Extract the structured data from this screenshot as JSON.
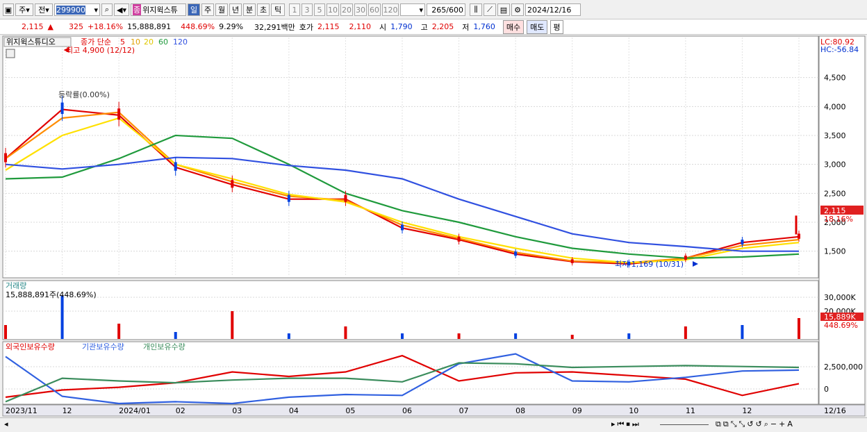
{
  "toolbar": {
    "period_type": "주",
    "prev_label": "전",
    "code": "299900",
    "name_badge": "종",
    "name": "위지윅스튜",
    "period_buttons": [
      "일",
      "주",
      "월",
      "년",
      "분",
      "초",
      "틱"
    ],
    "active_period": "일",
    "interval_buttons": [
      "1",
      "3",
      "5",
      "10",
      "20",
      "30",
      "60",
      "120"
    ],
    "count": "265",
    "count_max": "/600",
    "date": "2024/12/16"
  },
  "quote": {
    "price": "2,115",
    "change_arrow": "▲",
    "change": "325",
    "change_pct": "+18.16%",
    "volume": "15,888,891",
    "volume_pct": "448.69%",
    "rate": "9.29%",
    "amount": "32,291백만",
    "hoga_label": "호가",
    "hoga_ask": "2,115",
    "hoga_bid": "2,110",
    "open_label": "시",
    "open": "1,790",
    "high_label": "고",
    "high": "2,205",
    "low_label": "저",
    "low": "1,760",
    "buy_label": "매수",
    "sell_label": "매도",
    "eval_label": "평"
  },
  "price_panel": {
    "name_label": "위지윅스튜디오",
    "ma_title": "종가 단순",
    "ma_periods": [
      "5",
      "10",
      "20",
      "60",
      "120"
    ],
    "max_annotation": "최고 4,900 (12/12)",
    "min_annotation": "최저 1,169 (10/31)",
    "ratio_annotation": "등락률(0.00%)",
    "lc_label": "LC:80.92",
    "hc_label": "HC:-56.84",
    "last_price_badge": "2,115",
    "last_change_badge": "18.16%",
    "y_ticks": [
      "4,500",
      "4,000",
      "3,500",
      "3,000",
      "2,500",
      "2,000",
      "1,500"
    ]
  },
  "volume_panel": {
    "title": "거래량",
    "value_label": "15,888,891주(448.69%)",
    "y_ticks": [
      "30,000K",
      "20,000K"
    ],
    "last_badge": "15,889K",
    "last_pct": "448.69%"
  },
  "holding_panel": {
    "foreign_label": "외국인보유수량",
    "inst_label": "기관보유수량",
    "retail_label": "개인보유수량",
    "y_ticks": [
      "2,500,000",
      "0"
    ]
  },
  "x_axis": {
    "labels": [
      "2023/11",
      "12",
      "2024/01",
      "02",
      "03",
      "04",
      "05",
      "06",
      "07",
      "08",
      "09",
      "10",
      "11",
      "12",
      "12/16"
    ]
  },
  "colors": {
    "ma5": "#e00000",
    "ma10": "#ff8c00",
    "ma20": "#ffe000",
    "ma60": "#1f9a3c",
    "ma120": "#3050e0",
    "up": "#e00000",
    "down": "#0040e0",
    "foreign": "#e00000",
    "inst": "#3060e0",
    "retail": "#3a8c5c"
  },
  "chart_data": {
    "type": "line",
    "x_range": [
      "2023/11",
      "2024/12/16"
    ],
    "ylim": [
      1100,
      5000
    ],
    "x": [
      "2023/11",
      "2023/12",
      "2024/01",
      "2024/02",
      "2024/03",
      "2024/04",
      "2024/05",
      "2024/06",
      "2024/07",
      "2024/08",
      "2024/09",
      "2024/10",
      "2024/11",
      "2024/12",
      "2024/12/16"
    ],
    "series": [
      {
        "name": "5",
        "values": [
          3100,
          3950,
          3850,
          2950,
          2650,
          2400,
          2400,
          1900,
          1700,
          1450,
          1320,
          1280,
          1380,
          1650,
          1750
        ]
      },
      {
        "name": "10",
        "values": [
          3100,
          3800,
          3900,
          3000,
          2700,
          2450,
          2380,
          1950,
          1720,
          1480,
          1330,
          1300,
          1380,
          1600,
          1700
        ]
      },
      {
        "name": "20",
        "values": [
          2900,
          3500,
          3800,
          3000,
          2750,
          2480,
          2350,
          2000,
          1750,
          1550,
          1380,
          1300,
          1350,
          1550,
          1650
        ]
      },
      {
        "name": "60",
        "values": [
          2750,
          2780,
          3100,
          3500,
          3450,
          3000,
          2500,
          2200,
          2000,
          1750,
          1550,
          1450,
          1380,
          1400,
          1450
        ]
      },
      {
        "name": "120",
        "values": [
          3000,
          2920,
          3000,
          3120,
          3100,
          2980,
          2900,
          2750,
          2400,
          2100,
          1800,
          1650,
          1580,
          1500,
          1500
        ]
      }
    ],
    "last_close": 2115,
    "max_point": {
      "date": "2023/12/12",
      "value": 4900
    },
    "min_point": {
      "date": "2024/10/31",
      "value": 1169
    },
    "volume_last": "15,889K",
    "holdings": [
      {
        "name": "외국인보유수량",
        "values": [
          -0.3,
          0.5,
          0.8,
          1.3,
          2.5,
          2.0,
          2.5,
          4.3,
          1.5,
          2.4,
          2.5,
          2.1,
          1.7,
          -0.1,
          1.2
        ]
      },
      {
        "name": "기관보유수량",
        "values": [
          4.2,
          -0.2,
          -1.0,
          -0.8,
          -1.0,
          -0.3,
          0.0,
          -0.1,
          3.4,
          4.5,
          1.5,
          1.4,
          1.9,
          2.6,
          2.7
        ]
      },
      {
        "name": "개인보유수량",
        "values": [
          -0.8,
          1.8,
          1.5,
          1.3,
          1.6,
          1.8,
          1.8,
          1.4,
          3.5,
          3.4,
          3.0,
          3.1,
          3.2,
          3.1,
          3.0
        ]
      }
    ]
  }
}
